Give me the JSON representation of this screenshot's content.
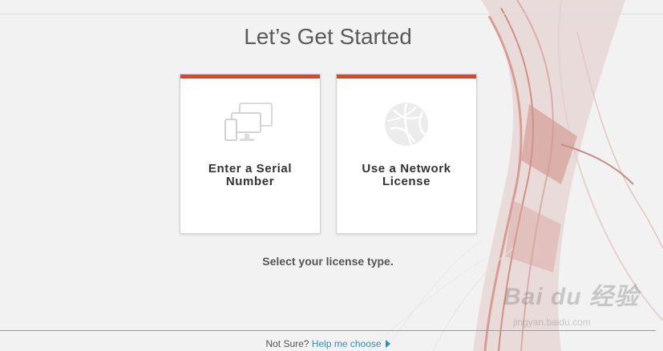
{
  "header": {
    "title": "Let’s Get Started"
  },
  "cards": [
    {
      "label_line1": "Enter a Serial",
      "label_line2": "Number",
      "icon": "devices-icon"
    },
    {
      "label_line1": "Use a Network",
      "label_line2": "License",
      "icon": "network-globe-icon"
    }
  ],
  "instruction": "Select your license type.",
  "footer": {
    "prefix": "Not Sure?",
    "link": "Help me choose"
  },
  "watermark": {
    "main": "Bai du 经验",
    "sub": "jingyan.baidu.com"
  },
  "colors": {
    "accent": "#d8462b",
    "link": "#2f8fc9",
    "background": "#f3f2f3"
  }
}
